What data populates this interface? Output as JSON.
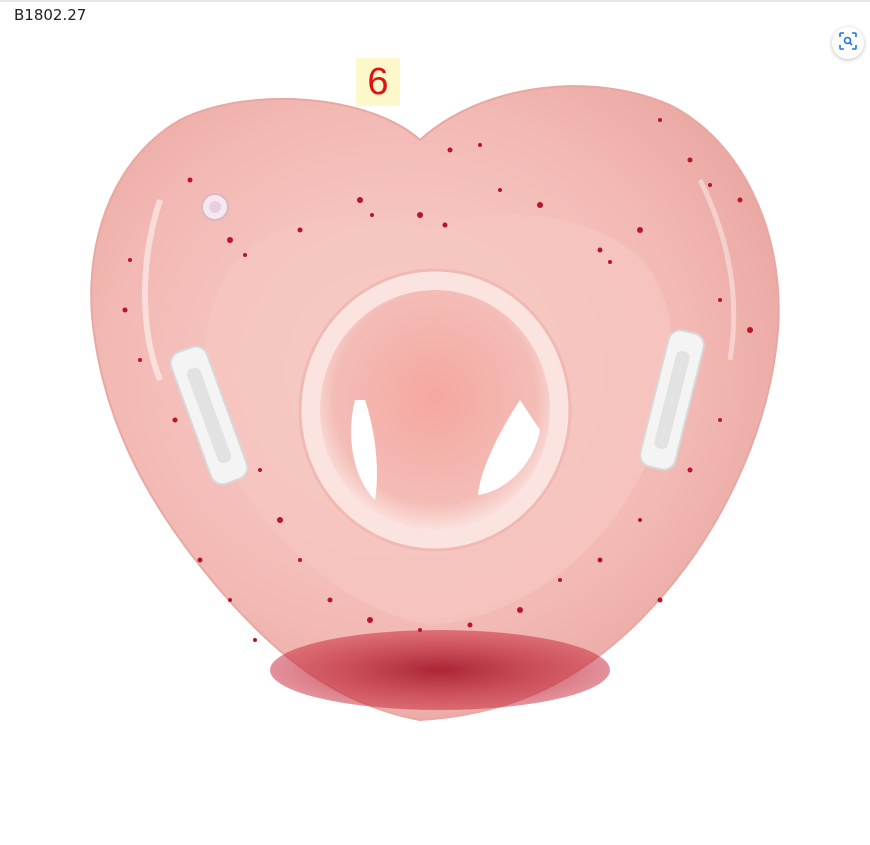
{
  "product_code": "B1802.27",
  "badge_number": "6",
  "lens_button": {
    "icon": "visual-search-icon"
  },
  "image": {
    "subject": "heart-shaped-baby-swim-float",
    "float_color": "#f3b8b4",
    "glitter_color": "#b8142a"
  }
}
